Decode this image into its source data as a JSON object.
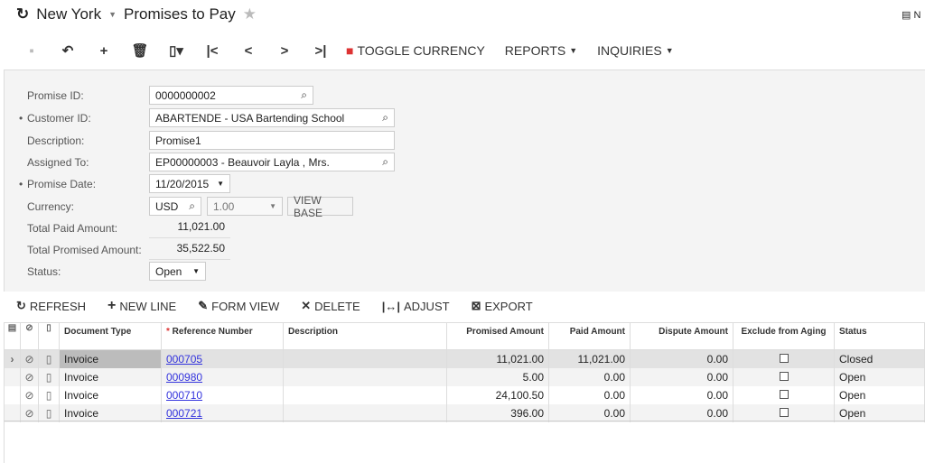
{
  "header": {
    "branch": "New York",
    "title": "Promises to Pay",
    "right_label": "N"
  },
  "toolbar": {
    "toggle_currency": "TOGGLE CURRENCY",
    "reports": "REPORTS",
    "inquiries": "INQUIRIES"
  },
  "form": {
    "promise_id": {
      "label": "Promise ID:",
      "value": "0000000002"
    },
    "customer_id": {
      "label": "Customer ID:",
      "value": "ABARTENDE - USA Bartending School"
    },
    "description": {
      "label": "Description:",
      "value": "Promise1"
    },
    "assigned_to": {
      "label": "Assigned To:",
      "value": "EP00000003 - Beauvoir Layla , Mrs."
    },
    "promise_date": {
      "label": "Promise Date:",
      "value": "11/20/2015"
    },
    "currency": {
      "label": "Currency:",
      "value": "USD",
      "rate": "1.00",
      "view_base": "VIEW BASE"
    },
    "total_paid": {
      "label": "Total Paid Amount:",
      "value": "11,021.00"
    },
    "total_promised": {
      "label": "Total Promised Amount:",
      "value": "35,522.50"
    },
    "status": {
      "label": "Status:",
      "value": "Open"
    }
  },
  "grid_toolbar": {
    "refresh": "REFRESH",
    "new_line": "NEW LINE",
    "form_view": "FORM VIEW",
    "delete": "DELETE",
    "adjust": "ADJUST",
    "export": "EXPORT"
  },
  "grid": {
    "columns": [
      "Document Type",
      "Reference Number",
      "Description",
      "Promised Amount",
      "Paid Amount",
      "Dispute Amount",
      "Exclude from Aging",
      "Status"
    ],
    "rows": [
      {
        "type": "Invoice",
        "ref": "000705",
        "desc": "",
        "promised": "11,021.00",
        "paid": "11,021.00",
        "dispute": "0.00",
        "status": "Closed"
      },
      {
        "type": "Invoice",
        "ref": "000980",
        "desc": "",
        "promised": "5.00",
        "paid": "0.00",
        "dispute": "0.00",
        "status": "Open"
      },
      {
        "type": "Invoice",
        "ref": "000710",
        "desc": "",
        "promised": "24,100.50",
        "paid": "0.00",
        "dispute": "0.00",
        "status": "Open"
      },
      {
        "type": "Invoice",
        "ref": "000721",
        "desc": "",
        "promised": "396.00",
        "paid": "0.00",
        "dispute": "0.00",
        "status": "Open"
      }
    ]
  }
}
